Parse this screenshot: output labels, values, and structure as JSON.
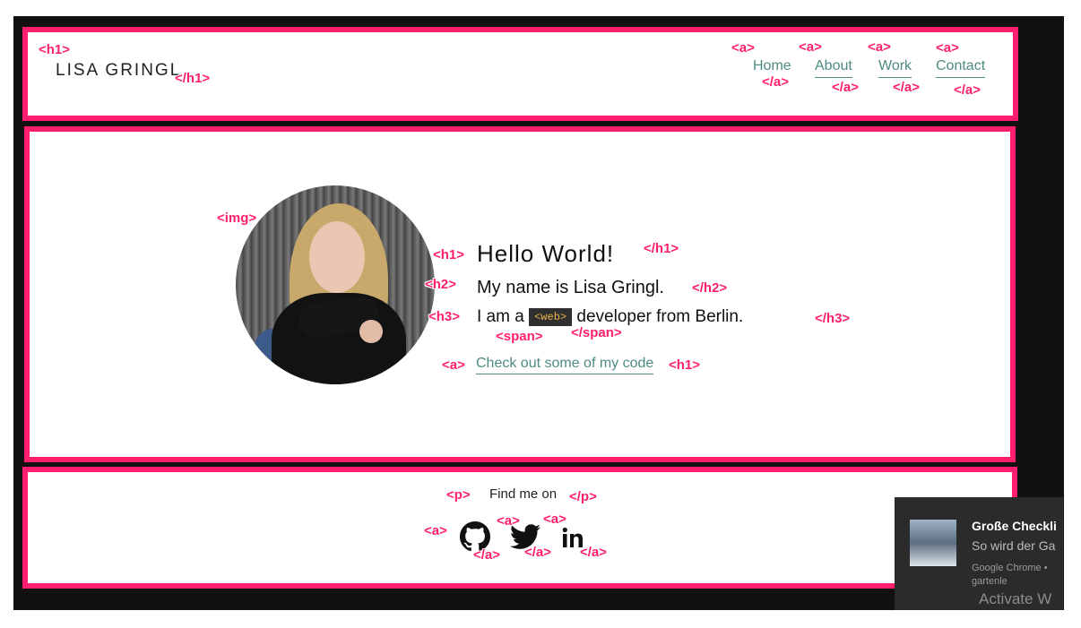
{
  "header": {
    "brand": "LISA GRINGL",
    "nav": [
      {
        "label": "Home"
      },
      {
        "label": "About"
      },
      {
        "label": "Work"
      },
      {
        "label": "Contact"
      }
    ]
  },
  "hero": {
    "greeting": "Hello World!",
    "name_line": "My name is Lisa Gringl.",
    "intro_prefix": "I am a",
    "intro_code": "<web>",
    "intro_suffix": "developer from Berlin.",
    "code_link": "Check out some of my code"
  },
  "footer": {
    "find_me": "Find me on",
    "social": [
      {
        "icon": "github-icon"
      },
      {
        "icon": "twitter-icon"
      },
      {
        "icon": "linkedin-icon"
      }
    ]
  },
  "tags": {
    "h1_open": "<h1>",
    "h1_close": "</h1>",
    "h2_open": "<h2>",
    "h2_close": "</h2>",
    "h3_open": "<h3>",
    "h3_close": "</h3>",
    "a_open": "<a>",
    "a_close": "</a>",
    "img": "<img>",
    "span_open": "<span>",
    "span_close": "</span>",
    "p_open": "<p>",
    "p_close": "</p>"
  },
  "notification": {
    "title": "Große Checkli",
    "subtitle": "So wird der Ga",
    "source": "Google Chrome •",
    "extra": "gartenle"
  },
  "watermark": "Activate W",
  "colors": {
    "highlight": "#ff1f6e",
    "link": "#4f8a83",
    "frame": "#111111",
    "code_bg": "#2f2f2f",
    "code_text": "#e8b34a"
  }
}
